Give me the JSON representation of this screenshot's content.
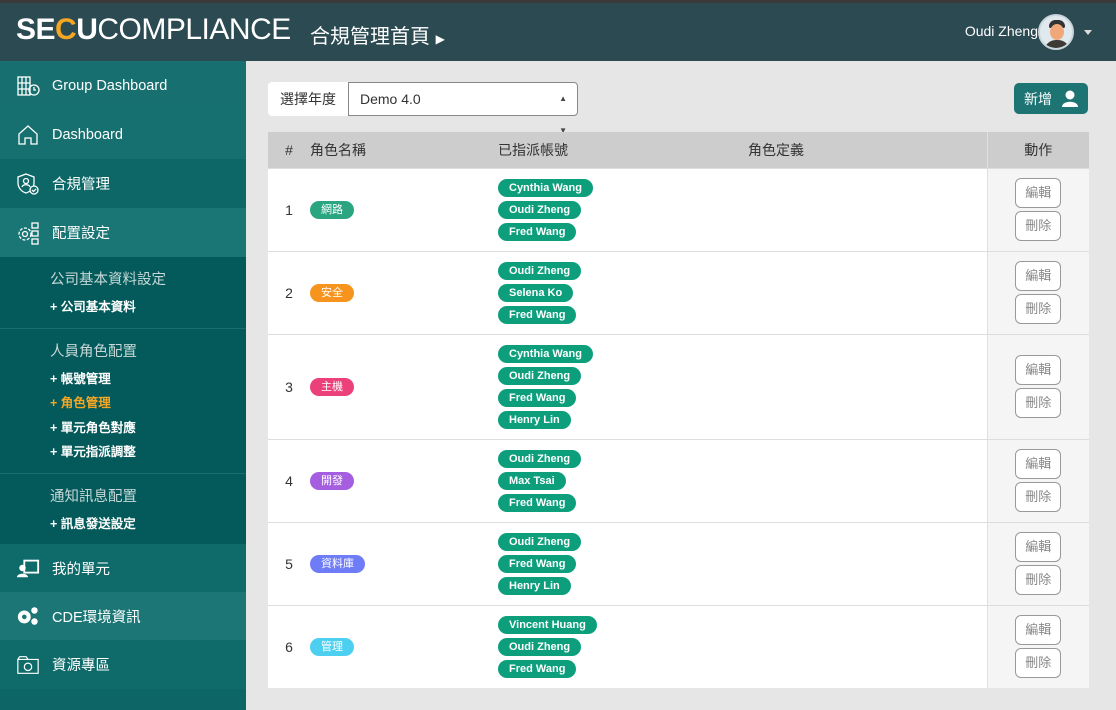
{
  "header": {
    "logo": "SECUCOMPLIANCE",
    "logo_parts": [
      "SE",
      "C",
      "U",
      "COMPLIANCE"
    ],
    "title": "合規管理首頁",
    "user": "Oudi Zheng"
  },
  "sidebar": {
    "items": [
      {
        "label": "Group Dashboard",
        "icon": "building-clock-icon"
      },
      {
        "label": "Dashboard",
        "icon": "home-icon"
      },
      {
        "label": "合規管理",
        "icon": "shield-user-icon"
      },
      {
        "label": "配置設定",
        "icon": "gear-checklist-icon"
      }
    ],
    "groups": [
      {
        "title": "公司基本資料設定",
        "items": [
          "+ 公司基本資料"
        ]
      },
      {
        "title": "人員角色配置",
        "items": [
          "+ 帳號管理",
          "+ 角色管理",
          "+ 單元角色對應",
          "+ 單元指派調整"
        ]
      },
      {
        "title": "通知訊息配置",
        "items": [
          "+ 訊息發送設定"
        ]
      }
    ],
    "bottom": [
      {
        "label": "我的單元",
        "icon": "user-screen-icon"
      },
      {
        "label": "CDE環境資訊",
        "icon": "gears-icon"
      },
      {
        "label": "資源專區",
        "icon": "folder-box-icon"
      }
    ]
  },
  "toolbar": {
    "year_label": "選擇年度",
    "year_value": "Demo 4.0",
    "add_label": "新增"
  },
  "table": {
    "headers": [
      "#",
      "角色名稱",
      "已指派帳號",
      "角色定義",
      "動作"
    ],
    "edit": "編輯",
    "delete": "刪除",
    "rows": [
      {
        "no": "1",
        "role": "網路",
        "color": "#2aa57f",
        "accounts": [
          "Cynthia Wang",
          "Oudi Zheng",
          "Fred Wang"
        ]
      },
      {
        "no": "2",
        "role": "安全",
        "color": "#f7941d",
        "accounts": [
          "Oudi Zheng",
          "Selena Ko",
          "Fred Wang"
        ]
      },
      {
        "no": "3",
        "role": "主機",
        "color": "#ec407a",
        "accounts": [
          "Cynthia Wang",
          "Oudi Zheng",
          "Fred Wang",
          "Henry Lin"
        ]
      },
      {
        "no": "4",
        "role": "開發",
        "color": "#a55ee0",
        "accounts": [
          "Oudi Zheng",
          "Max Tsai",
          "Fred Wang"
        ]
      },
      {
        "no": "5",
        "role": "資料庫",
        "color": "#6f7cf7",
        "accounts": [
          "Oudi Zheng",
          "Fred Wang",
          "Henry Lin"
        ]
      },
      {
        "no": "6",
        "role": "管理",
        "color": "#4dd0f0",
        "accounts": [
          "Vincent Huang",
          "Oudi Zheng",
          "Fred Wang"
        ]
      }
    ]
  }
}
